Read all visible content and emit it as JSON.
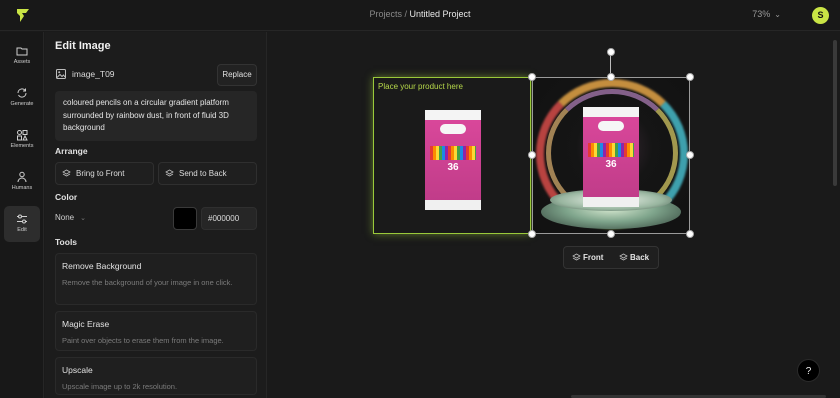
{
  "header": {
    "breadcrumb_parent": "Projects",
    "breadcrumb_sep": "/",
    "breadcrumb_current": "Untitled Project",
    "zoom": "73%",
    "avatar_initial": "S"
  },
  "rail": {
    "items": [
      {
        "label": "Assets",
        "icon": "folder-icon"
      },
      {
        "label": "Generate",
        "icon": "refresh-icon"
      },
      {
        "label": "Elements",
        "icon": "shapes-icon"
      },
      {
        "label": "Humans",
        "icon": "person-icon"
      },
      {
        "label": "Edit",
        "icon": "sliders-icon"
      }
    ],
    "active": "Edit"
  },
  "panel": {
    "title": "Edit Image",
    "image_name": "image_T09",
    "replace_label": "Replace",
    "prompt": "coloured pencils on a circular gradient platform surrounded by rainbow dust, in front of fluid 3D background",
    "arrange_title": "Arrange",
    "bring_front_label": "Bring to Front",
    "send_back_label": "Send to Back",
    "color_title": "Color",
    "color_mode": "None",
    "color_hex": "#000000",
    "tools_title": "Tools",
    "tools": [
      {
        "title": "Remove Background",
        "desc": "Remove the background of your image in one click."
      },
      {
        "title": "Magic Erase",
        "desc": "Paint over objects to erase them from the image."
      },
      {
        "title": "Upscale",
        "desc": "Upscale image up to 2k resolution."
      }
    ]
  },
  "canvas": {
    "placeholder_label": "Place your product here",
    "product": {
      "count_text": "36"
    },
    "front_label": "Front",
    "back_label": "Back",
    "help_label": "?"
  },
  "colors": {
    "accent": "#9ac93a",
    "avatar_bg": "#c9e445",
    "background": "#1a1a1a"
  }
}
